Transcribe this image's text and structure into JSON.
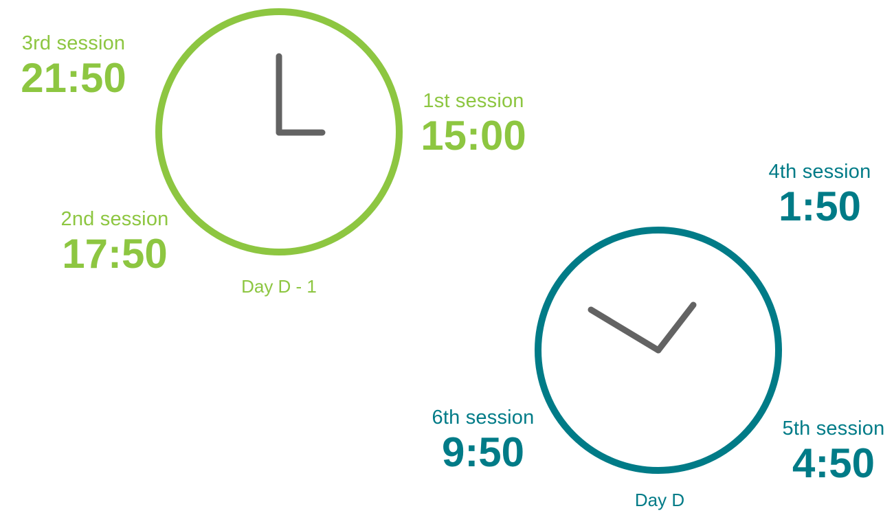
{
  "colors": {
    "previous_day": "#8dc641",
    "current_day": "#007b87",
    "clock_hands": "#636363"
  },
  "icons": {
    "previous_day_clock": "clock-icon",
    "current_day_clock": "clock-icon"
  },
  "day_previous": {
    "label": "Day D - 1",
    "clock_time": "15:00",
    "sessions": [
      {
        "label": "1st session",
        "time": "15:00"
      },
      {
        "label": "2nd session",
        "time": "17:50"
      },
      {
        "label": "3rd session",
        "time": "21:50"
      }
    ]
  },
  "day_current": {
    "label": "Day D",
    "clock_time": "1:50",
    "sessions": [
      {
        "label": "4th session",
        "time": "1:50"
      },
      {
        "label": "5th session",
        "time": "4:50"
      },
      {
        "label": "6th session",
        "time": "9:50"
      }
    ]
  }
}
